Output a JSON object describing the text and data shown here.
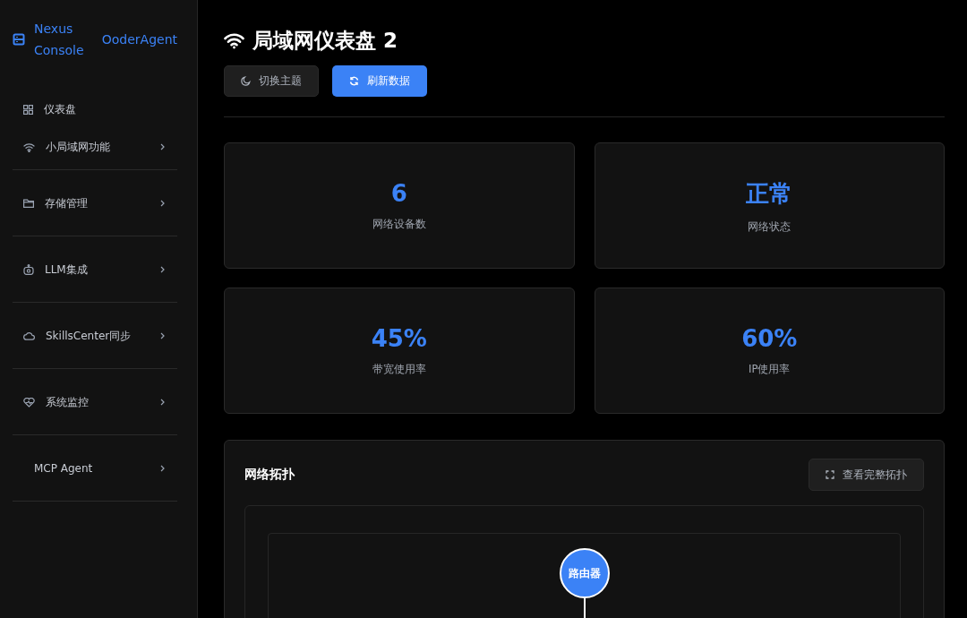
{
  "sidebar": {
    "brand": {
      "name": "Nexus Console",
      "product": "OoderAgent"
    },
    "sections": [
      {
        "items": [
          {
            "label": "仪表盘",
            "expandable": false
          },
          {
            "label": "小局域网功能",
            "expandable": true
          }
        ]
      },
      {
        "items": [
          {
            "label": "存储管理",
            "expandable": true
          }
        ]
      },
      {
        "items": [
          {
            "label": "LLM集成",
            "expandable": true
          }
        ]
      },
      {
        "items": [
          {
            "label": "SkillsCenter同步",
            "expandable": true
          }
        ]
      },
      {
        "items": [
          {
            "label": "系统监控",
            "expandable": true
          }
        ]
      },
      {
        "items": [
          {
            "label": "MCP Agent",
            "expandable": true
          }
        ]
      }
    ]
  },
  "header": {
    "title": "局域网仪表盘 2",
    "buttons": [
      {
        "label": "切换主题",
        "kind": "secondary"
      },
      {
        "label": "刷新数据",
        "kind": "primary"
      }
    ]
  },
  "stats": [
    {
      "value": "6",
      "label": "网络设备数"
    },
    {
      "value": "正常",
      "label": "网络状态"
    },
    {
      "value": "45%",
      "label": "带宽使用率"
    },
    {
      "value": "60%",
      "label": "IP使用率"
    }
  ],
  "topology": {
    "title": "网络拓扑",
    "button": "查看完整拓扑",
    "nodes": [
      {
        "label": "路由器"
      }
    ]
  }
}
